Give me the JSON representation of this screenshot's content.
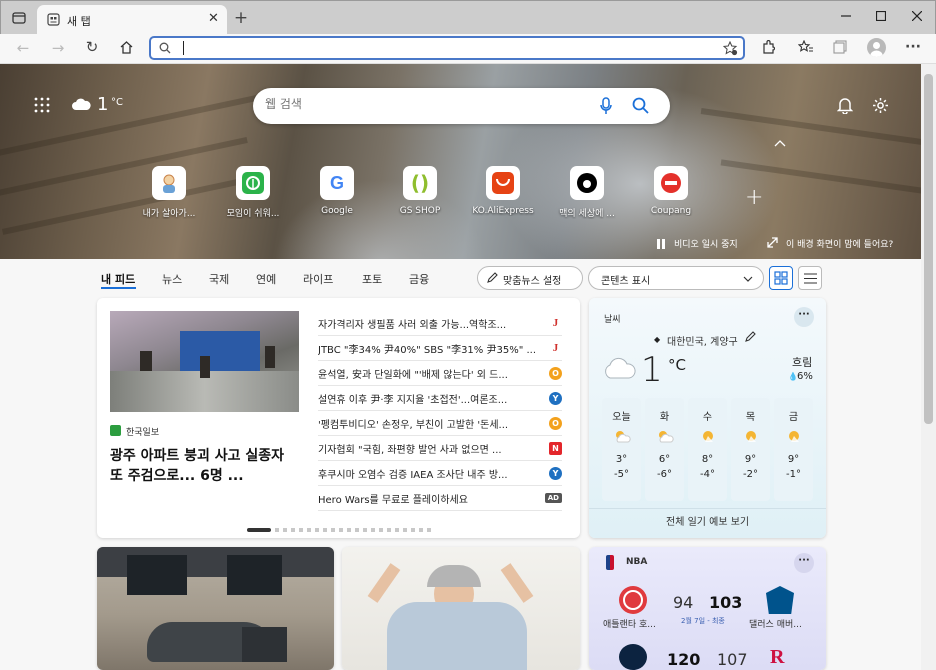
{
  "tab": {
    "title": "새 탭"
  },
  "search": {
    "placeholder": "웹 검색"
  },
  "weather_top": {
    "temp": "1",
    "unit": "°C"
  },
  "quicklinks": [
    {
      "label": "내가 살아가...",
      "icon": "person-icon",
      "color": "#d8a25b"
    },
    {
      "label": "모임이 쉬워...",
      "icon": "leaf-icon",
      "color": "#2bb34a"
    },
    {
      "label": "Google",
      "icon": "google-icon",
      "color": "#4285f4"
    },
    {
      "label": "GS SHOP",
      "icon": "gs-icon",
      "color": "#8fbe2e"
    },
    {
      "label": "KO.AliExpress",
      "icon": "aliexpress-icon",
      "color": "#e64314"
    },
    {
      "label": "맥의 세상에 ...",
      "icon": "apple-icon",
      "color": "#000000"
    },
    {
      "label": "Coupang",
      "icon": "coupang-icon",
      "color": "#e4312b"
    }
  ],
  "hero_controls": {
    "pause": "비디오 일시 중지",
    "feedback": "이 배경 화면이 맘에 들어요?"
  },
  "feed_nav": {
    "items": [
      "내 피드",
      "뉴스",
      "국제",
      "연예",
      "라이프",
      "포토",
      "금융"
    ],
    "personalize": "맞춤뉴스 설정",
    "content_display": "콘텐츠 표시"
  },
  "main_story": {
    "source": "한국일보",
    "title": "광주 아파트 붕괴 사고 실종자 또 주검으로... 6명 ..."
  },
  "headlines": [
    {
      "text": "자가격리자 생필품 사러 외출 가능...역학조...",
      "badge": "J",
      "color": "#d0312d"
    },
    {
      "text": "JTBC \"李34% 尹40%\" SBS \"李31% 尹35%\" ...",
      "badge": "J",
      "color": "#d0312d"
    },
    {
      "text": "윤석열, 安과 단일화에 \"'배제 않는다' 외 드...",
      "badge": "O",
      "color": "#f3a11c"
    },
    {
      "text": "설연휴 이후 尹·李 지지율 '초접전'...여론조...",
      "badge": "Y",
      "color": "#1f70c1"
    },
    {
      "text": "'펭컴투비디오' 손정우, 부친이 고발한 '돈세...",
      "badge": "O",
      "color": "#f3a11c"
    },
    {
      "text": "기자협회 \"국힘, 좌편향 발언 사과 없으면 ...",
      "badge": "N",
      "color": "#e3262b"
    },
    {
      "text": "후쿠시마 오염수 검증 IAEA 조사단 내주 방...",
      "badge": "Y",
      "color": "#1f70c1"
    },
    {
      "text": "Hero Wars를 무료로 플레이하세요",
      "badge": "AD",
      "color": "#555555"
    }
  ],
  "weather": {
    "title": "날씨",
    "location": "대한민국, 계양구",
    "temp": "1",
    "unit": "°C",
    "condition": "흐림",
    "precip": "6%",
    "days": [
      {
        "day": "오늘",
        "hi": "3°",
        "lo": "-5°"
      },
      {
        "day": "화",
        "hi": "6°",
        "lo": "-6°"
      },
      {
        "day": "수",
        "hi": "8°",
        "lo": "-4°"
      },
      {
        "day": "목",
        "hi": "9°",
        "lo": "-2°"
      },
      {
        "day": "금",
        "hi": "9°",
        "lo": "-1°"
      }
    ],
    "forecast_link": "전체 일기 예보 보기"
  },
  "nba": {
    "title": "NBA",
    "game1": {
      "home_score": "94",
      "away_score": "103",
      "home": "애틀랜타 호...",
      "away": "댈러스 매버...",
      "status": "2월 7일 - 최종"
    },
    "game2": {
      "home_score": "120",
      "away_score": "107"
    }
  }
}
